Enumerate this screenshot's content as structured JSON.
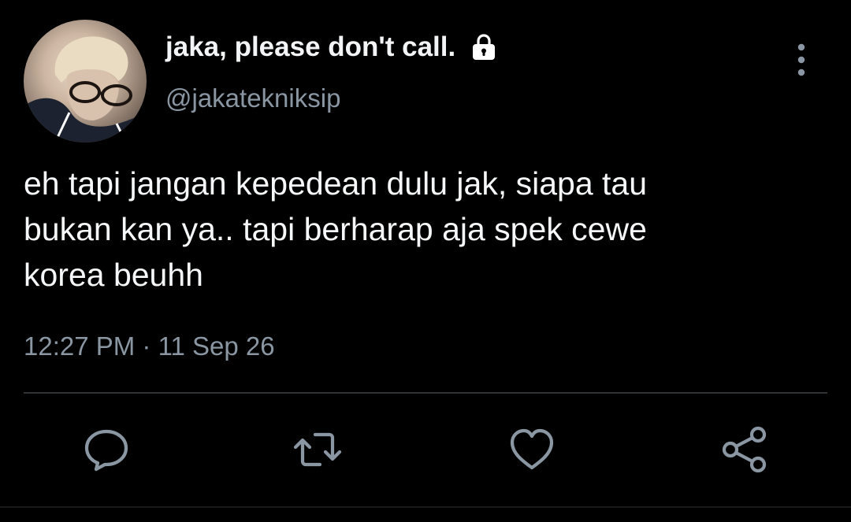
{
  "tweet": {
    "display_name": "jaka, please don't call.",
    "handle": "@jakatekniksip",
    "text": "eh tapi jangan kepedean dulu jak, siapa tau\nbukan kan ya.. tapi berharap aja spek cewe\nkorea beuhh",
    "timestamp": "12:27 PM · 11 Sep 26",
    "protected_icon": "lock-icon",
    "avatar": "profile-photo"
  },
  "actions": [
    {
      "name": "reply",
      "icon": "reply-icon"
    },
    {
      "name": "retweet",
      "icon": "retweet-icon"
    },
    {
      "name": "like",
      "icon": "heart-icon"
    },
    {
      "name": "share",
      "icon": "share-icon"
    }
  ],
  "colors": {
    "background": "#000000",
    "primary_text": "#f5f7f8",
    "secondary_text": "#8a97a3",
    "icon": "#8a97a3",
    "divider": "#2f3336"
  }
}
